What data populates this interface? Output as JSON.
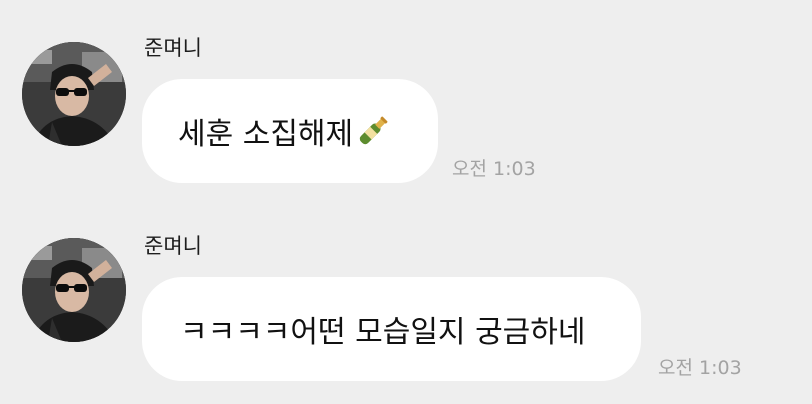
{
  "messages": [
    {
      "sender": "준며니",
      "text": "세훈 소집해제",
      "emoji": "champagne-bottle-icon",
      "time": "오전 1:03"
    },
    {
      "sender": "준며니",
      "text": "ㅋㅋㅋㅋ어떤 모습일지 궁금하네",
      "time": "오전 1:03"
    }
  ],
  "colors": {
    "background": "#eeeeee",
    "bubble": "#ffffff",
    "text": "#111111",
    "time": "#a3a3a3"
  }
}
